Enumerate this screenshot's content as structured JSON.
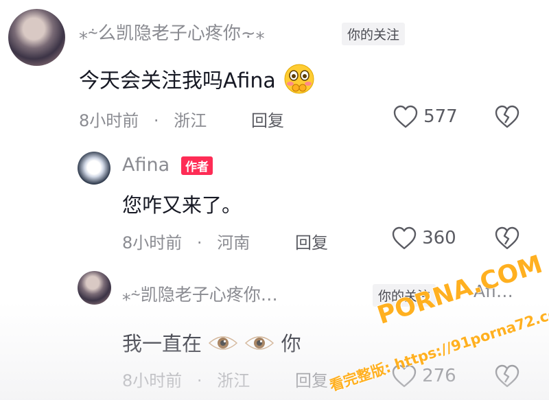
{
  "comments": [
    {
      "username": "⁎⸞么凯隐老子心疼你⸟⁎",
      "tag": "你的关注",
      "text": "今天会关注我吗Afina",
      "time": "8小时前",
      "location": "浙江",
      "reply": "回复",
      "likes": "577"
    },
    {
      "username": "Afina",
      "badge": "作者",
      "text": "您咋又来了。",
      "time": "8小时前",
      "location": "河南",
      "reply": "回复",
      "likes": "360"
    },
    {
      "username": "⁎⸞凯隐老子心疼你…",
      "tag": "你的关注",
      "reply_to": "Afi…",
      "text_before": "我一直在",
      "text_after": "你",
      "time": "8小时前",
      "location": "浙江",
      "reply": "回复",
      "likes": "276"
    }
  ],
  "separator": "·",
  "watermark": {
    "site": "PORNA.COM",
    "line": "看完整版: https://91porna72.com"
  },
  "icons": {
    "like": "heart-outline-icon",
    "dislike": "broken-heart-icon",
    "emoji_shy": "shy-face-emoji",
    "emoji_eyes": "eye-emoji"
  }
}
